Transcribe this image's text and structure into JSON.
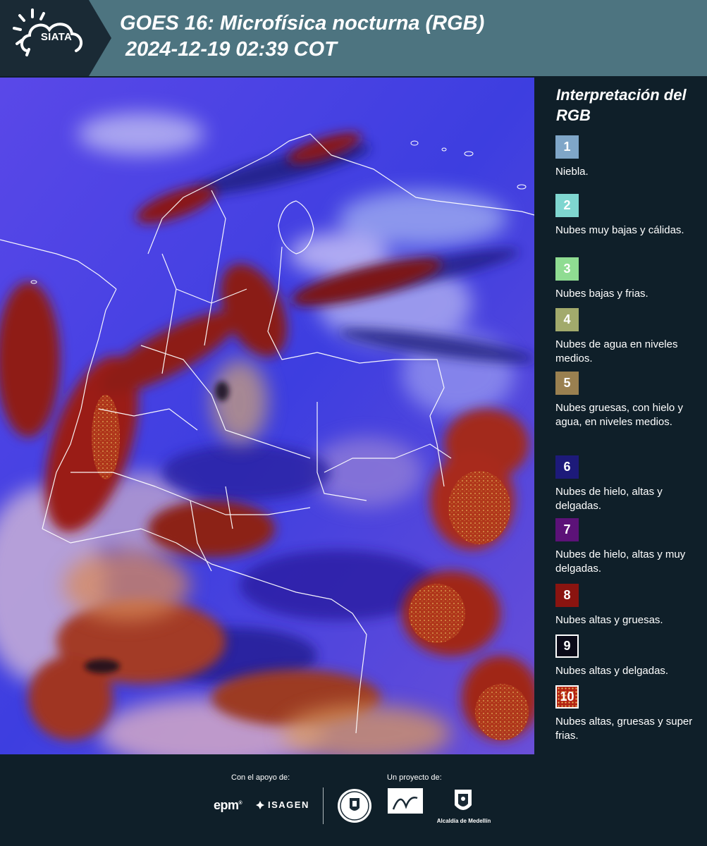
{
  "header": {
    "logo_text": "SIATA",
    "title_line1": "GOES 16: Microfísica nocturna (RGB)",
    "title_line2": "2024-12-19 02:39 COT"
  },
  "map": {
    "product": "Microfísica nocturna (RGB)",
    "satellite": "GOES 16"
  },
  "legend": {
    "title": "Interpretación del RGB",
    "items": [
      {
        "number": "1",
        "label": "Niebla.",
        "color": "#7fa6c8"
      },
      {
        "number": "2",
        "label": "Nubes muy bajas y cálidas.",
        "color": "#7fd6d0"
      },
      {
        "number": "3",
        "label": "Nubes bajas y frias.",
        "color": "#8fdc92"
      },
      {
        "number": "4",
        "label": "Nubes de agua en niveles medios.",
        "color": "#a2aa6c"
      },
      {
        "number": "5",
        "label": "Nubes gruesas, con hielo y agua, en niveles medios.",
        "color": "#9a8050"
      },
      {
        "number": "6",
        "label": "Nubes de hielo, altas y delgadas.",
        "color": "#1d1a7a"
      },
      {
        "number": "7",
        "label": "Nubes de hielo, altas y muy delgadas.",
        "color": "#5c1278"
      },
      {
        "number": "8",
        "label": "Nubes altas y gruesas.",
        "color": "#8a1410"
      },
      {
        "number": "9",
        "label": "Nubes altas y delgadas.",
        "color": "#0a0a18"
      },
      {
        "number": "10",
        "label": "Nubes altas, gruesas y super frias.",
        "color": "#b42414"
      }
    ]
  },
  "footer": {
    "support_label": "Con el apoyo de:",
    "project_label": "Un proyecto de:",
    "sponsors": [
      "epm",
      "ISAGEN"
    ],
    "partners_caption": "Alcaldía de Medellín"
  }
}
